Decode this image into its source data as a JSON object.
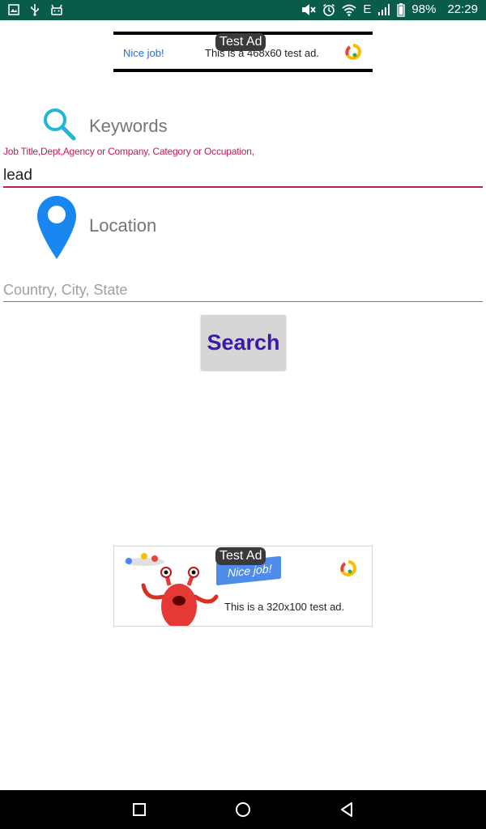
{
  "status_bar": {
    "battery": "98%",
    "time": "22:29",
    "network": "E",
    "left_icons": [
      "image-icon",
      "usb-icon",
      "android-icon"
    ],
    "right_icons": [
      "mute-icon",
      "alarm-icon",
      "wifi-icon",
      "signal-icon",
      "battery-icon"
    ],
    "background": "#0a5c4a"
  },
  "ad_top": {
    "label": "Test Ad",
    "nice": "Nice job!",
    "text": "This is a 468x60 test ad."
  },
  "keywords": {
    "title": "Keywords",
    "hint": "Job Title,Dept,Agency or Company, Category or Occupation,",
    "value": "lead",
    "accent": "#c2185b"
  },
  "location": {
    "title": "Location",
    "placeholder": "Country, City, State",
    "value": ""
  },
  "search": {
    "label": "Search",
    "color": "#3b1aa8"
  },
  "ad_bottom": {
    "label": "Test Ad",
    "banner": "Nice job!",
    "text": "This is a 320x100 test ad."
  },
  "nav": {
    "icons": [
      "recents-icon",
      "home-icon",
      "back-icon"
    ]
  }
}
